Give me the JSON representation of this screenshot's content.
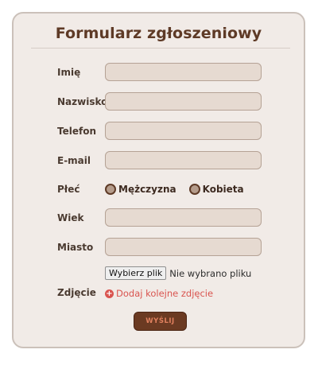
{
  "form": {
    "title": "Formularz zgłoszeniowy",
    "fields": {
      "first_name": {
        "label": "Imię",
        "value": ""
      },
      "last_name": {
        "label": "Nazwisko",
        "value": ""
      },
      "phone": {
        "label": "Telefon",
        "value": ""
      },
      "email": {
        "label": "E-mail",
        "value": ""
      },
      "age": {
        "label": "Wiek",
        "value": ""
      },
      "city": {
        "label": "Miasto",
        "value": ""
      }
    },
    "gender": {
      "label": "Płeć",
      "options": [
        "Mężczyzna",
        "Kobieta"
      ]
    },
    "photo": {
      "label": "Zdjęcie",
      "choose_button": "Wybierz plik",
      "status": "Nie wybrano pliku",
      "add_more": "Dodaj kolejne zdjęcie"
    },
    "submit_label": "WYŚLIJ"
  },
  "colors": {
    "card_background": "#f1ebe7",
    "title_text": "#5e3a26",
    "input_fill": "#e6dad1",
    "accent_red": "#d9544f",
    "button_fill": "#6b3a22"
  }
}
